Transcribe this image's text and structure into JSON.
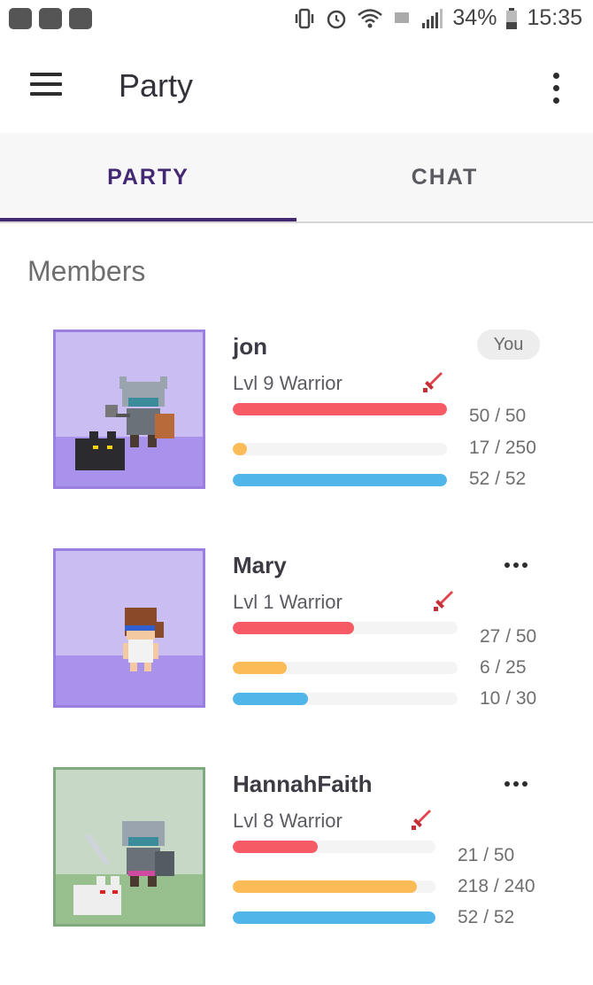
{
  "status_bar": {
    "battery": "34%",
    "time": "15:35"
  },
  "app_bar": {
    "title": "Party"
  },
  "tabs": [
    {
      "label": "PARTY",
      "selected": true
    },
    {
      "label": "CHAT",
      "selected": false
    }
  ],
  "section": {
    "title": "Members"
  },
  "members": [
    {
      "name": "jon",
      "level": "Lvl 9 Warrior",
      "badge": "You",
      "hp_text": "50 / 50",
      "xp_text": "17 / 250",
      "mp_text": "52 / 52",
      "hp": [
        50,
        50
      ],
      "xp": [
        17,
        250
      ],
      "mp": [
        52,
        52
      ]
    },
    {
      "name": "Mary",
      "level": "Lvl 1 Warrior",
      "hp_text": "27 / 50",
      "xp_text": "6 / 25",
      "mp_text": "10 / 30",
      "hp": [
        27,
        50
      ],
      "xp": [
        6,
        25
      ],
      "mp": [
        10,
        30
      ]
    },
    {
      "name": "HannahFaith",
      "level": "Lvl 8 Warrior",
      "hp_text": "21 / 50",
      "xp_text": "218 / 240",
      "mp_text": "52 / 52",
      "hp": [
        21,
        50
      ],
      "xp": [
        218,
        240
      ],
      "mp": [
        52,
        52
      ]
    }
  ],
  "colors": {
    "accent": "#432874",
    "hp": "#f65a64",
    "xp": "#fbbc58",
    "mp": "#50b5e9"
  }
}
